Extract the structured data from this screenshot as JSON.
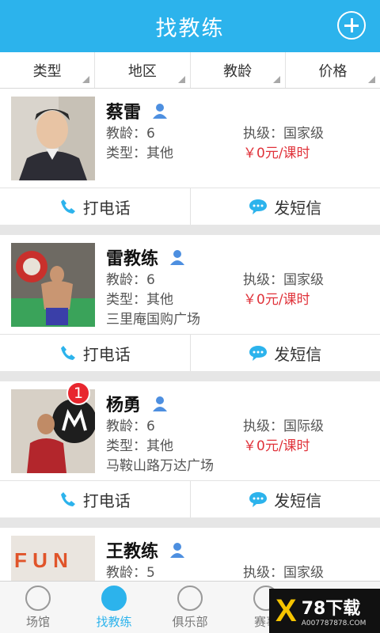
{
  "header": {
    "title": "找教练"
  },
  "filters": [
    "类型",
    "地区",
    "教龄",
    "价格"
  ],
  "coaches": [
    {
      "name": "蔡雷",
      "teach_years": "教龄：6",
      "type": "类型：其他",
      "level": "执级：国家级",
      "price": "￥0元/课时",
      "address": "",
      "badge": ""
    },
    {
      "name": "雷教练",
      "teach_years": "教龄：6",
      "type": "类型：其他",
      "level": "执级：国家级",
      "price": "￥0元/课时",
      "address": "三里庵国购广场",
      "badge": ""
    },
    {
      "name": "杨勇",
      "teach_years": "教龄：6",
      "type": "类型：其他",
      "level": "执级：国际级",
      "price": "￥0元/课时",
      "address": "马鞍山路万达广场",
      "badge": "1"
    },
    {
      "name": "王教练",
      "teach_years": "教龄：5",
      "type": "",
      "level": "执级：国家级",
      "price": "",
      "address": "",
      "badge": ""
    }
  ],
  "actions": {
    "call": "打电话",
    "sms": "发短信"
  },
  "tabs": [
    {
      "label": "场馆",
      "icon": "location-icon"
    },
    {
      "label": "找教练",
      "icon": "coach-icon"
    },
    {
      "label": "俱乐部",
      "icon": "club-icon"
    },
    {
      "label": "赛事",
      "icon": "event-icon"
    },
    {
      "label": "",
      "icon": "profile-icon"
    }
  ],
  "watermark": {
    "mark": "X",
    "title": "78下载",
    "url": "A007787878.COM"
  },
  "colors": {
    "primary": "#2cb3ec",
    "price": "#e0323a",
    "badge": "#e8262e"
  }
}
